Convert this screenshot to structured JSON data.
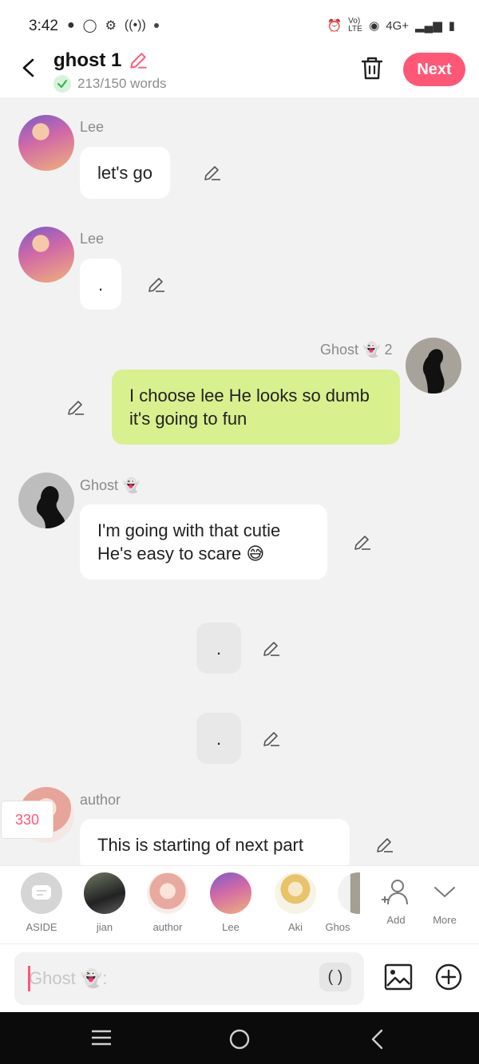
{
  "status": {
    "time": "3:42",
    "network": "4G+",
    "volte": "Vo) LTE"
  },
  "header": {
    "title": "ghost 1",
    "word_count": "213/150 words",
    "next_label": "Next"
  },
  "messages": [
    {
      "sender": "Lee",
      "text": "let's go"
    },
    {
      "sender": "Lee",
      "text": "."
    },
    {
      "sender": "Ghost 👻 2",
      "text": "I choose lee He looks so dumb it's going to fun"
    },
    {
      "sender": "Ghost 👻",
      "text": "I'm going with that cutie He's easy to scare 😅"
    },
    {
      "sender": "",
      "text": "."
    },
    {
      "sender": "",
      "text": "."
    },
    {
      "sender": "author",
      "text": "This is starting of next part"
    }
  ],
  "counter_badge": "330",
  "characters": [
    {
      "label": "ASIDE"
    },
    {
      "label": "jian"
    },
    {
      "label": "author"
    },
    {
      "label": "Lee"
    },
    {
      "label": "Aki"
    },
    {
      "label": "Ghos"
    }
  ],
  "tools": {
    "add_label": "Add",
    "more_label": "More"
  },
  "composer": {
    "placeholder": "Ghost 👻:",
    "paren": "( )"
  },
  "colors": {
    "accent": "#ff5776",
    "my_bubble": "#d8f08e",
    "background": "#f2f2f2"
  }
}
